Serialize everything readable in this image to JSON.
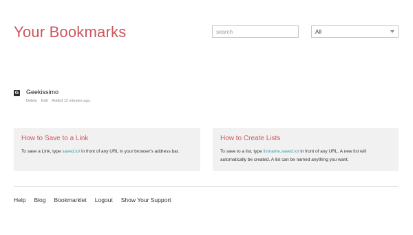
{
  "header": {
    "title": "Your Bookmarks",
    "search_placeholder": "search",
    "filter_value": "All"
  },
  "bookmarks": [
    {
      "favicon": "G",
      "title": "Geekissimo",
      "actions": [
        "Delete",
        "Edit"
      ],
      "added": "Added 12 minutes ago."
    }
  ],
  "info_boxes": {
    "save": {
      "title": "How to Save to a Link",
      "text_before": "To save a Link, type ",
      "link": "saved.io/",
      "text_after": " in front of any URL in your browser's address bar."
    },
    "lists": {
      "title": "How to Create Lists",
      "text_before": "To save to a list, type ",
      "link": "listname.saved.io/",
      "text_after": " in front of any URL. A new list will automatically be created. A list can be named anything you want."
    }
  },
  "footer": {
    "links": [
      "Help",
      "Blog",
      "Bookmarklet",
      "Logout",
      "Show Your Support"
    ]
  },
  "colors": {
    "accent": "#d0545c",
    "link": "#3a9ea5",
    "panel": "#f1f1f1"
  }
}
